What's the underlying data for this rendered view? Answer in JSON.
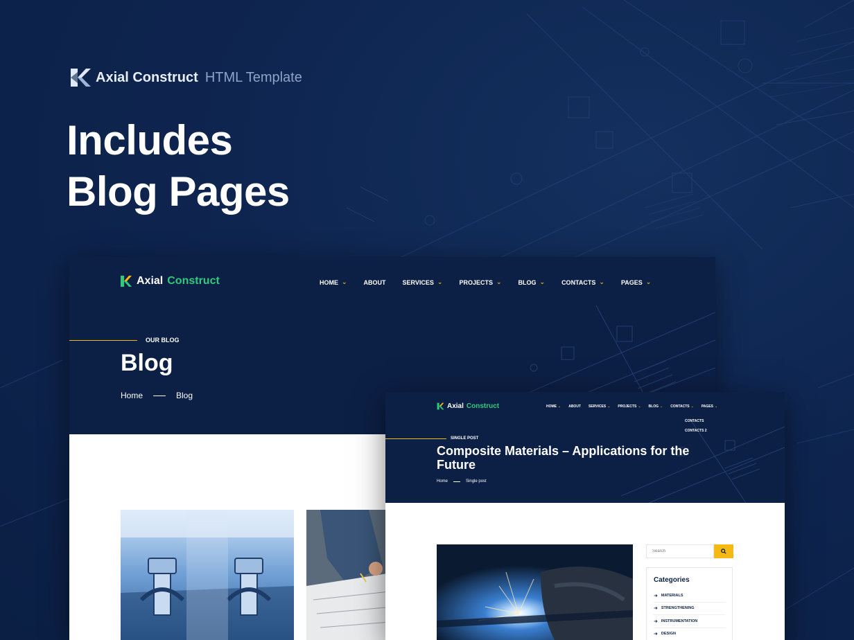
{
  "brand": {
    "name": "Axial Construct",
    "subtitle": "HTML Template"
  },
  "headline": {
    "line1": "Includes",
    "line2": "Blog Pages"
  },
  "colors": {
    "background": "#0c2246",
    "accent_yellow": "#f5b914",
    "accent_green": "#2ecb7a",
    "navy": "#0c1f45"
  },
  "blog_mockup": {
    "logo_part1": "Axial",
    "logo_part2": "Construct",
    "menu": [
      "HOME",
      "ABOUT",
      "SERVICES",
      "PROJECTS",
      "BLOG",
      "CONTACTS",
      "PAGES"
    ],
    "eyebrow": "OUR BLOG",
    "title": "Blog",
    "breadcrumb": {
      "home": "Home",
      "current": "Blog"
    }
  },
  "post_mockup": {
    "logo_part1": "Axial",
    "logo_part2": "Construct",
    "menu": [
      "HOME",
      "ABOUT",
      "SERVICES",
      "PROJECTS",
      "BLOG",
      "CONTACTS",
      "PAGES"
    ],
    "dropdown": [
      "CONTACTS",
      "CONTACTS 2"
    ],
    "eyebrow": "SINGLE POST",
    "title": "Composite Materials – Applications for the Future",
    "breadcrumb": {
      "home": "Home",
      "current": "Single post"
    },
    "search_placeholder": "Search",
    "categories_title": "Categories",
    "categories": [
      "MATERIALS",
      "STRENGTHENING",
      "INSTRUMENTATION",
      "DESIGN"
    ]
  }
}
